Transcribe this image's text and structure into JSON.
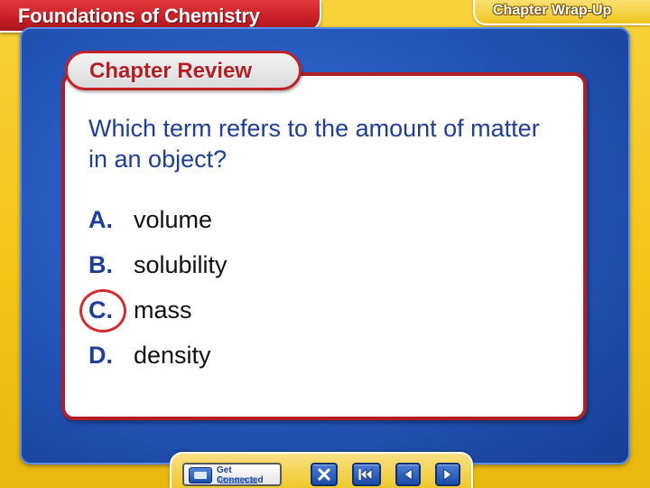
{
  "header": {
    "title": "Foundations of Chemistry",
    "section": "Chapter Wrap-Up"
  },
  "card": {
    "label": "Chapter Review",
    "question": "Which term refers to the amount of matter in an object?",
    "answers": [
      {
        "letter": "A.",
        "text": "volume",
        "selected": false
      },
      {
        "letter": "B.",
        "text": "solubility",
        "selected": false
      },
      {
        "letter": "C.",
        "text": "mass",
        "selected": true
      },
      {
        "letter": "D.",
        "text": "density",
        "selected": false
      }
    ]
  },
  "nav": {
    "get_connected_label": "Get Connected",
    "get_connected_url": "glencoe.com",
    "buttons": [
      {
        "icon": "close-icon"
      },
      {
        "icon": "rewind-icon"
      },
      {
        "icon": "previous-icon"
      },
      {
        "icon": "next-icon"
      }
    ]
  },
  "colors": {
    "background": "#f4c417",
    "board": "#2354b8",
    "accent_red": "#c81f25",
    "question_blue": "#1d3f9a"
  }
}
